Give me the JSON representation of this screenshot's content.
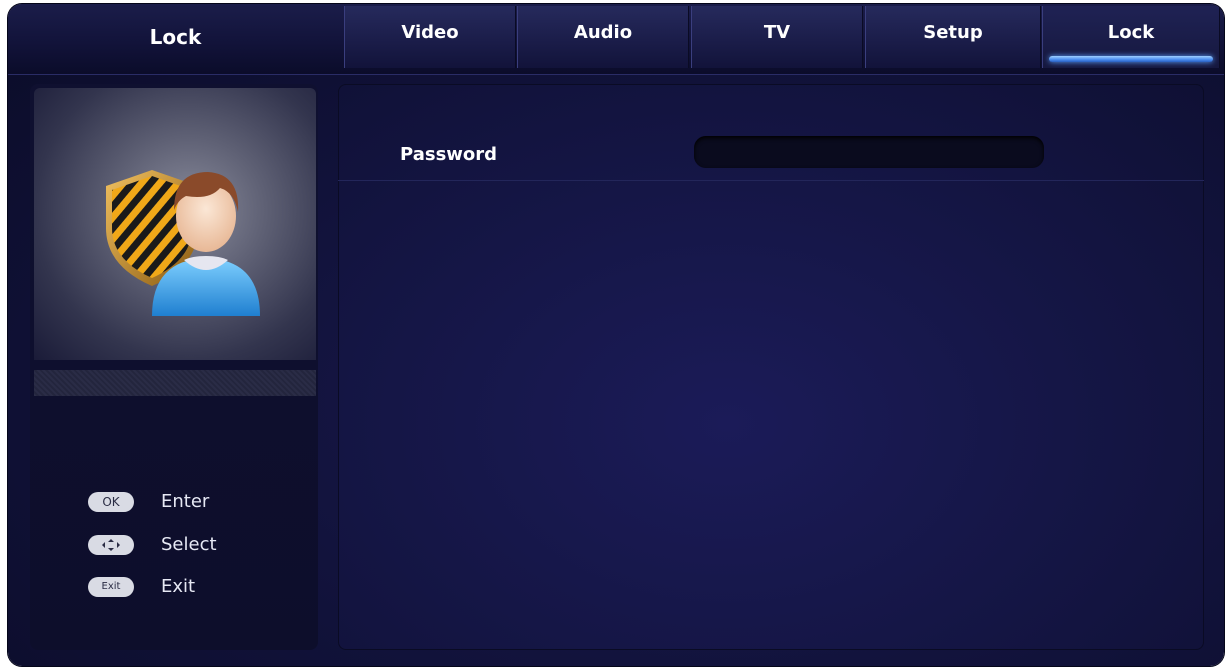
{
  "header": {
    "breadcrumb": "Lock",
    "tabs": [
      {
        "label": "Video",
        "active": false
      },
      {
        "label": "Audio",
        "active": false
      },
      {
        "label": "TV",
        "active": false
      },
      {
        "label": "Setup",
        "active": false
      },
      {
        "label": "Lock",
        "active": true
      }
    ]
  },
  "sidebar": {
    "illustration_icon": "user-lock-icon",
    "hints": [
      {
        "key": "OK",
        "label": "Enter",
        "icon": "ok-button-icon"
      },
      {
        "key": "",
        "label": "Select",
        "icon": "dpad-icon"
      },
      {
        "key": "Exit",
        "label": "Exit",
        "icon": "exit-button-icon"
      }
    ]
  },
  "content": {
    "password_label": "Password",
    "password_value": ""
  },
  "colors": {
    "accent": "#4a8df0",
    "background": "#11123a",
    "text": "#ffffff"
  }
}
